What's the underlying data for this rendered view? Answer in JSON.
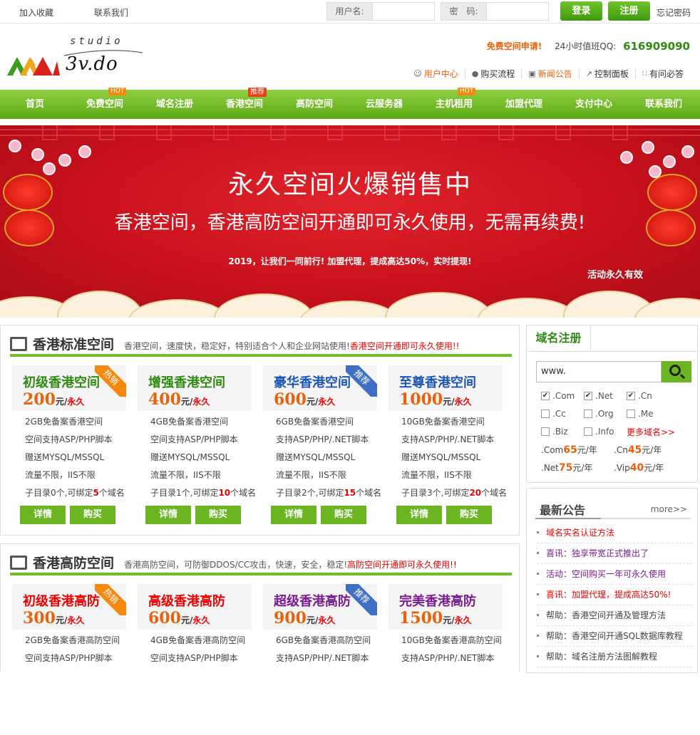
{
  "topbar": {
    "bookmark": "加入收藏",
    "contact": "联系我们",
    "username_label": "用户名:",
    "password_label": "密　码:",
    "login": "登录",
    "register": "注册",
    "forgot": "忘记密码"
  },
  "logo": {
    "studio": "studio",
    "domain": "3v.do"
  },
  "header": {
    "free_apply": "免费空间申请!",
    "qq_label": "24小时值班QQ:",
    "qq": "616909090"
  },
  "quicklinks": [
    {
      "label": "用户中心",
      "icon": "user-icon",
      "color": "#e8610c"
    },
    {
      "label": "购买流程",
      "icon": "map-pin-icon",
      "color": "#333"
    },
    {
      "label": "新闻公告",
      "icon": "news-icon",
      "color": "#e8610c"
    },
    {
      "label": "控制面板",
      "icon": "pin-icon",
      "color": "#333"
    },
    {
      "label": "有问必答",
      "icon": "grid-icon",
      "color": "#333"
    }
  ],
  "nav": [
    {
      "label": "首页"
    },
    {
      "label": "免费空间",
      "tag": "HOT"
    },
    {
      "label": "域名注册"
    },
    {
      "label": "香港空间",
      "tag": "推荐"
    },
    {
      "label": "高防空间"
    },
    {
      "label": "云服务器"
    },
    {
      "label": "主机租用",
      "tag": "HOT"
    },
    {
      "label": "加盟代理"
    },
    {
      "label": "支付中心"
    },
    {
      "label": "联系我们"
    }
  ],
  "banner": {
    "title": "永久空间火爆销售中",
    "subtitle": "香港空间，香港高防空间开通即可永久使用，无需再续费!",
    "line3": "2019，让我们一同前行! 加盟代理，提成高达50%，实时提现!",
    "note": "活动永久有效"
  },
  "section1": {
    "title": "香港标准空间",
    "desc": "香港空间，速度快，稳定好，特别适合个人和企业网站使用!",
    "red": "香港空间开通即可永久使用!!",
    "cards": [
      {
        "name": "初级香港空间",
        "price": "200",
        "unit": "元/",
        "period": "永久",
        "ribbon": "热销",
        "name_color": "#2e8b12",
        "price_color": "#e8610c",
        "ribbon_color": "#f5880f",
        "f1": "2GB免备案香港空间",
        "f2": "空间支持ASP/PHP脚本",
        "f3": "赠送MYSQL/MSSQL",
        "f4": "流量不限，IIS不限",
        "f5a": "子目录0个,可绑定",
        "f5b": "5",
        "f5c": "个域名"
      },
      {
        "name": "增强香港空间",
        "price": "400",
        "unit": "元/",
        "period": "永久",
        "ribbon": "",
        "name_color": "#2e8b12",
        "price_color": "#e8610c",
        "ribbon_color": "",
        "f1": "4GB免备案香港空间",
        "f2": "空间支持ASP/PHP脚本",
        "f3": "赠送MYSQL/MSSQL",
        "f4": "流量不限，IIS不限",
        "f5a": "子目录1个,可绑定",
        "f5b": "10",
        "f5c": "个域名"
      },
      {
        "name": "豪华香港空间",
        "price": "600",
        "unit": "元/",
        "period": "永久",
        "ribbon": "推荐",
        "name_color": "#1b55b5",
        "price_color": "#e8610c",
        "ribbon_color": "#3f6fc5",
        "f1": "6GB免备案香港空间",
        "f2": "支持ASP/PHP/.NET脚本",
        "f3": "赠送MYSQL/MSSQL",
        "f4": "流量不限，IIS不限",
        "f5a": "子目录2个,可绑定",
        "f5b": "15",
        "f5c": "个域名"
      },
      {
        "name": "至尊香港空间",
        "price": "1000",
        "unit": "元/",
        "period": "永久",
        "ribbon": "",
        "name_color": "#1b55b5",
        "price_color": "#e8610c",
        "ribbon_color": "",
        "f1": "10GB免备案香港空间",
        "f2": "支持ASP/PHP/.NET脚本",
        "f3": "赠送MYSQL/MSSQL",
        "f4": "流量不限，IIS不限",
        "f5a": "子目录3个,可绑定",
        "f5b": "20",
        "f5c": "个域名"
      }
    ],
    "btn_detail": "详情",
    "btn_buy": "购买"
  },
  "section2": {
    "title": "香港高防空间",
    "desc": "香港高防空间，可防御DDOS/CC攻击，快速，安全，稳定!",
    "red": "高防空间开通即可永久使用!!",
    "cards": [
      {
        "name": "初级香港高防",
        "price": "300",
        "unit": "元/",
        "period": "永久",
        "ribbon": "热销",
        "name_color": "#e00",
        "price_color": "#e8610c",
        "ribbon_color": "#f5880f",
        "f1": "2GB免备案香港高防空间",
        "f2": "空间支持ASP/PHP脚本"
      },
      {
        "name": "高级香港高防",
        "price": "600",
        "unit": "元/",
        "period": "永久",
        "ribbon": "",
        "name_color": "#e00",
        "price_color": "#e8610c",
        "ribbon_color": "",
        "f1": "4GB免备案香港高防空间",
        "f2": "空间支持ASP/PHP脚本"
      },
      {
        "name": "超级香港高防",
        "price": "900",
        "unit": "元/",
        "period": "永久",
        "ribbon": "推荐",
        "name_color": "#7a1b8f",
        "price_color": "#e8610c",
        "ribbon_color": "#3f6fc5",
        "f1": "6GB免备案香港高防空间",
        "f2": "支持ASP/PHP/.NET脚本"
      },
      {
        "name": "完美香港高防",
        "price": "1500",
        "unit": "元/",
        "period": "永久",
        "ribbon": "",
        "name_color": "#7a1b8f",
        "price_color": "#e8610c",
        "ribbon_color": "",
        "f1": "10GB免备案香港高防空间",
        "f2": "支持ASP/PHP/.NET脚本"
      }
    ]
  },
  "domain_box": {
    "title": "域名注册",
    "www": "www.",
    "tlds": [
      {
        "label": ".Com",
        "checked": true
      },
      {
        "label": ".Net",
        "checked": true
      },
      {
        "label": ".Cn",
        "checked": true
      },
      {
        "label": ".Cc",
        "checked": false
      },
      {
        "label": ".Org",
        "checked": false
      },
      {
        "label": ".Me",
        "checked": false
      },
      {
        "label": ".Biz",
        "checked": false
      },
      {
        "label": ".Info",
        "checked": false
      }
    ],
    "more": "更多域名>>",
    "prices": [
      {
        "tld": ".Com",
        "price": "65",
        "unit": "元/年"
      },
      {
        "tld": ".Cn",
        "price": "45",
        "unit": "元/年"
      },
      {
        "tld": ".Net",
        "price": "75",
        "unit": "元/年"
      },
      {
        "tld": ".Vip",
        "price": "40",
        "unit": "元/年"
      }
    ]
  },
  "notice": {
    "title": "最新公告",
    "more": "more>>",
    "items": [
      {
        "text": "域名实名认证方法",
        "color": "#e00"
      },
      {
        "text": "喜讯：独享带宽正式推出了",
        "color": "#7a1b8f"
      },
      {
        "text": "活动：空间购买一年可永久使用",
        "color": "#7a1b8f"
      },
      {
        "text": "喜讯：加盟代理，提成高达50%!",
        "color": "#e00"
      },
      {
        "text": "帮助：香港空间开通及管理方法",
        "color": "#444"
      },
      {
        "text": "帮助：香港空间开通SQL数据库教程",
        "color": "#444"
      },
      {
        "text": "帮助：域名注册方法图解教程",
        "color": "#444"
      }
    ]
  }
}
